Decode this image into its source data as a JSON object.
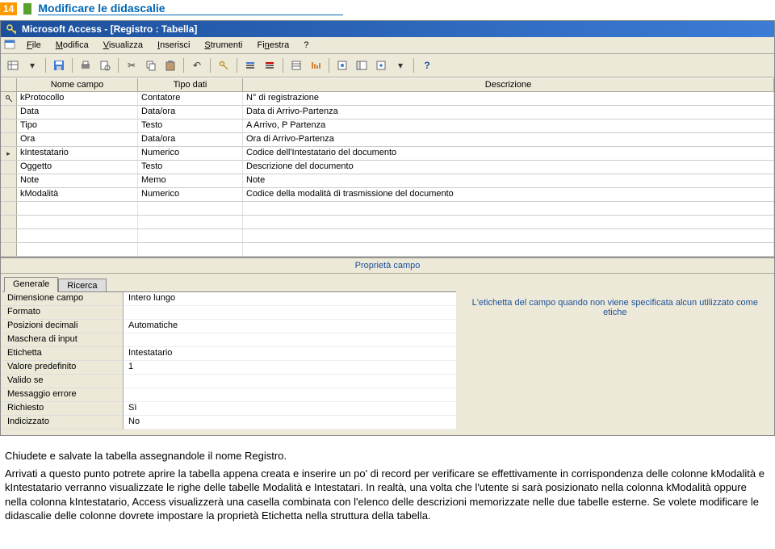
{
  "page": {
    "number": "14",
    "title": "Modificare le didascalie"
  },
  "window": {
    "title": "Microsoft Access - [Registro : Tabella]"
  },
  "menu": {
    "file": "File",
    "modifica": "Modifica",
    "visualizza": "Visualizza",
    "inserisci": "Inserisci",
    "strumenti": "Strumenti",
    "finestra": "Finestra",
    "help": "?"
  },
  "grid": {
    "headers": {
      "name": "Nome campo",
      "type": "Tipo dati",
      "desc": "Descrizione"
    },
    "rows": [
      {
        "sel": "key",
        "name": "kProtocollo",
        "type": "Contatore",
        "desc": "N° di registrazione"
      },
      {
        "sel": "",
        "name": "Data",
        "type": "Data/ora",
        "desc": "Data di Arrivo-Partenza"
      },
      {
        "sel": "",
        "name": "Tipo",
        "type": "Testo",
        "desc": "A Arrivo, P Partenza"
      },
      {
        "sel": "",
        "name": "Ora",
        "type": "Data/ora",
        "desc": "Ora di Arrivo-Partenza"
      },
      {
        "sel": "current",
        "name": "kIntestatario",
        "type": "Numerico",
        "desc": "Codice dell'Intestatario del documento"
      },
      {
        "sel": "",
        "name": "Oggetto",
        "type": "Testo",
        "desc": "Descrizione del documento"
      },
      {
        "sel": "",
        "name": "Note",
        "type": "Memo",
        "desc": "Note"
      },
      {
        "sel": "",
        "name": "kModalità",
        "type": "Numerico",
        "desc": "Codice della modalità di trasmissione del documento"
      }
    ],
    "empty_rows": 4
  },
  "prop_panel": {
    "title": "Proprietà campo",
    "tabs": {
      "general": "Generale",
      "lookup": "Ricerca"
    },
    "rows": [
      {
        "label": "Dimensione campo",
        "value": "Intero lungo"
      },
      {
        "label": "Formato",
        "value": ""
      },
      {
        "label": "Posizioni decimali",
        "value": "Automatiche"
      },
      {
        "label": "Maschera di input",
        "value": ""
      },
      {
        "label": "Etichetta",
        "value": "Intestatario"
      },
      {
        "label": "Valore predefinito",
        "value": "1"
      },
      {
        "label": "Valido se",
        "value": ""
      },
      {
        "label": "Messaggio errore",
        "value": ""
      },
      {
        "label": "Richiesto",
        "value": "Sì"
      },
      {
        "label": "Indicizzato",
        "value": "No"
      }
    ],
    "help_text": "L'etichetta del campo quando non viene specificata alcun utilizzato come etiche"
  },
  "body": {
    "p1": "Chiudete e salvate la tabella assegnandole il nome Registro.",
    "p2": "Arrivati a questo punto potrete aprire la tabella appena creata e inserire un po' di record per verificare se effettivamente in corrispondenza delle colonne kModalità e kIntestatario verranno visualizzate le righe delle tabelle Modalità e Intestatari. In realtà, una volta che l'utente si sarà posizionato nella colonna kModalità oppure nella colonna kIntestatario, Access visualizzerà una casella combinata con l'elenco delle descrizioni memorizzate nelle due tabelle esterne. Se volete modificare le didascalie delle colonne dovrete impostare la proprietà Etichetta nella struttura della tabella."
  }
}
